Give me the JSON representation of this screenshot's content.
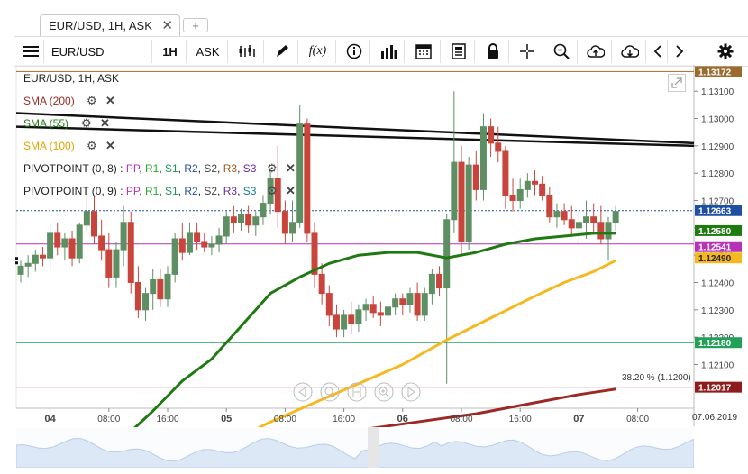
{
  "tab": {
    "title": "EUR/USD, 1H, ASK",
    "close": "✕",
    "add": "+"
  },
  "toolbar": {
    "symbol": "EUR/USD",
    "period": "1H",
    "side": "ASK",
    "fx": "f(x)"
  },
  "chart_title": "EUR/USD, 1H, ASK",
  "colors": {
    "sma200": "#9b2a26",
    "sma55": "#1f7a12",
    "sma100": "#f5b820",
    "up": "#5e8f63",
    "down": "#c9453c"
  },
  "indicators": {
    "sma200": "SMA (200)",
    "sma55": "SMA (55)",
    "sma100": "SMA (100)",
    "pivot1": {
      "name": "PIVOTPOINT (0, 8)",
      "sep": " : ",
      "pp": "PP",
      "r1": "R1",
      "s1": "S1",
      "r2": "R2",
      "s2": "S2",
      "r3": "R3",
      "s3": "S3"
    },
    "pivot2": {
      "name": "PIVOTPOINT (0, 9)",
      "sep": " : ",
      "pp": "PP",
      "r1": "R1",
      "s1": "S1",
      "r2": "R2",
      "s2": "S2",
      "r3": "R3",
      "s3": "S3"
    }
  },
  "fib_label": "38.20 % (1.1200)",
  "date_label": "07.06.2019",
  "chart_data": {
    "type": "candlestick",
    "title": "EUR/USD, 1H, ASK",
    "ylim": [
      1.1194,
      1.1317
    ],
    "y_ticks": [
      "1.13100",
      "1.13000",
      "1.12900",
      "1.12800",
      "1.12700",
      "1.12600",
      "1.12500",
      "1.12400",
      "1.12300",
      "1.12200",
      "1.12100"
    ],
    "y_tick_values": [
      1.131,
      1.13,
      1.129,
      1.128,
      1.127,
      1.126,
      1.125,
      1.124,
      1.123,
      1.122,
      1.121
    ],
    "x_ticks": [
      "04",
      "08:00",
      "16:00",
      "05",
      "08:00",
      "16:00",
      "06",
      "08:00",
      "16:00",
      "07",
      "08:00"
    ],
    "x_tick_index": [
      4,
      12,
      20,
      28,
      36,
      44,
      52,
      60,
      68,
      76,
      84
    ],
    "price_tags": [
      {
        "label": "1.13172",
        "value": 1.13172,
        "color": "#9b6a2e",
        "line": true
      },
      {
        "label": "1.12663",
        "value": 1.12663,
        "color": "#1e4fa3",
        "line": true,
        "dashed": true
      },
      {
        "label": "1.12580",
        "value": 1.1258,
        "color": "#1f7a12",
        "line": false
      },
      {
        "label": "1.12541",
        "value": 1.12541,
        "color": "#b633b6",
        "line": true
      },
      {
        "label": "1.12490",
        "value": 1.1249,
        "color": "#f5b820",
        "line": false
      },
      {
        "label": "1.12180",
        "value": 1.1218,
        "color": "#22a05a",
        "line": true
      },
      {
        "label": "1.12017",
        "value": 1.12017,
        "color": "#8e1c1c",
        "line": true
      }
    ],
    "trendlines": [
      {
        "from": [
          0,
          1.1302
        ],
        "to": [
          89,
          1.1291
        ],
        "color": "#111"
      },
      {
        "from": [
          0,
          1.1297
        ],
        "to": [
          89,
          1.129
        ],
        "color": "#111"
      }
    ],
    "candles": [
      [
        1.1243,
        1.1248,
        1.124,
        1.1246
      ],
      [
        1.1246,
        1.125,
        1.1242,
        1.1247
      ],
      [
        1.1247,
        1.1252,
        1.1244,
        1.125
      ],
      [
        1.125,
        1.1253,
        1.1246,
        1.1249
      ],
      [
        1.1249,
        1.1262,
        1.1245,
        1.1258
      ],
      [
        1.1258,
        1.1262,
        1.125,
        1.1253
      ],
      [
        1.1253,
        1.1258,
        1.1248,
        1.1256
      ],
      [
        1.1256,
        1.1259,
        1.1246,
        1.1249
      ],
      [
        1.1249,
        1.1262,
        1.1247,
        1.1261
      ],
      [
        1.1261,
        1.1275,
        1.1258,
        1.1266
      ],
      [
        1.1266,
        1.1272,
        1.1254,
        1.1257
      ],
      [
        1.1257,
        1.1263,
        1.1248,
        1.1252
      ],
      [
        1.1252,
        1.1258,
        1.1238,
        1.1242
      ],
      [
        1.1242,
        1.1255,
        1.1238,
        1.1252
      ],
      [
        1.1252,
        1.1268,
        1.1246,
        1.1262
      ],
      [
        1.1262,
        1.1266,
        1.1236,
        1.124
      ],
      [
        1.124,
        1.1246,
        1.1227,
        1.123
      ],
      [
        1.123,
        1.1238,
        1.1226,
        1.1236
      ],
      [
        1.1236,
        1.1245,
        1.123,
        1.1241
      ],
      [
        1.1241,
        1.1245,
        1.1231,
        1.1234
      ],
      [
        1.1234,
        1.1246,
        1.1231,
        1.1243
      ],
      [
        1.1243,
        1.1258,
        1.124,
        1.1256
      ],
      [
        1.1256,
        1.1262,
        1.1248,
        1.1251
      ],
      [
        1.1251,
        1.1262,
        1.125,
        1.1258
      ],
      [
        1.1258,
        1.1262,
        1.1252,
        1.1255
      ],
      [
        1.1255,
        1.1258,
        1.1251,
        1.1253
      ],
      [
        1.1253,
        1.1257,
        1.125,
        1.1254
      ],
      [
        1.1254,
        1.126,
        1.1251,
        1.1257
      ],
      [
        1.1257,
        1.1266,
        1.1254,
        1.1264
      ],
      [
        1.1264,
        1.1268,
        1.1258,
        1.1262
      ],
      [
        1.1262,
        1.1267,
        1.1259,
        1.1265
      ],
      [
        1.1265,
        1.1268,
        1.1258,
        1.1261
      ],
      [
        1.1261,
        1.1266,
        1.1257,
        1.1264
      ],
      [
        1.1264,
        1.1272,
        1.1261,
        1.1269
      ],
      [
        1.1269,
        1.1282,
        1.1265,
        1.1278
      ],
      [
        1.1278,
        1.129,
        1.126,
        1.1266
      ],
      [
        1.1266,
        1.127,
        1.1254,
        1.1258
      ],
      [
        1.1258,
        1.127,
        1.1255,
        1.1262
      ],
      [
        1.1262,
        1.1305,
        1.126,
        1.1298
      ],
      [
        1.1298,
        1.13,
        1.1255,
        1.1258
      ],
      [
        1.1258,
        1.1262,
        1.1238,
        1.1243
      ],
      [
        1.1243,
        1.1247,
        1.1232,
        1.1236
      ],
      [
        1.1236,
        1.1239,
        1.1224,
        1.1228
      ],
      [
        1.1228,
        1.1232,
        1.122,
        1.1223
      ],
      [
        1.1223,
        1.123,
        1.122,
        1.1228
      ],
      [
        1.1228,
        1.1233,
        1.1221,
        1.1225
      ],
      [
        1.1225,
        1.1232,
        1.1222,
        1.123
      ],
      [
        1.123,
        1.1234,
        1.1226,
        1.1232
      ],
      [
        1.1232,
        1.1235,
        1.1227,
        1.1229
      ],
      [
        1.1229,
        1.1233,
        1.1224,
        1.1228
      ],
      [
        1.1228,
        1.1233,
        1.1222,
        1.1231
      ],
      [
        1.1231,
        1.1236,
        1.1228,
        1.1234
      ],
      [
        1.1234,
        1.1236,
        1.1228,
        1.1232
      ],
      [
        1.1232,
        1.1238,
        1.1229,
        1.1236
      ],
      [
        1.1236,
        1.124,
        1.1226,
        1.1228
      ],
      [
        1.1228,
        1.1238,
        1.1226,
        1.1236
      ],
      [
        1.1236,
        1.1245,
        1.1232,
        1.1243
      ],
      [
        1.1243,
        1.1246,
        1.1235,
        1.1238
      ],
      [
        1.1238,
        1.1265,
        1.1203,
        1.1263
      ],
      [
        1.1263,
        1.131,
        1.1258,
        1.1284
      ],
      [
        1.1284,
        1.129,
        1.125,
        1.1255
      ],
      [
        1.1255,
        1.1286,
        1.1252,
        1.1283
      ],
      [
        1.1283,
        1.1288,
        1.127,
        1.1274
      ],
      [
        1.1274,
        1.1302,
        1.127,
        1.1297
      ],
      [
        1.1297,
        1.13,
        1.1286,
        1.1291
      ],
      [
        1.1291,
        1.1297,
        1.1284,
        1.1288
      ],
      [
        1.1288,
        1.129,
        1.1267,
        1.1272
      ],
      [
        1.1272,
        1.1278,
        1.1266,
        1.127
      ],
      [
        1.127,
        1.1278,
        1.1267,
        1.1274
      ],
      [
        1.1274,
        1.128,
        1.1271,
        1.1277
      ],
      [
        1.1277,
        1.1281,
        1.1272,
        1.1276
      ],
      [
        1.1276,
        1.1279,
        1.127,
        1.1272
      ],
      [
        1.1272,
        1.1275,
        1.1262,
        1.1264
      ],
      [
        1.1264,
        1.1269,
        1.126,
        1.1266
      ],
      [
        1.1266,
        1.1269,
        1.1261,
        1.1263
      ],
      [
        1.1263,
        1.1268,
        1.1257,
        1.126
      ],
      [
        1.126,
        1.1266,
        1.1254,
        1.1262
      ],
      [
        1.1262,
        1.127,
        1.1256,
        1.1264
      ],
      [
        1.1264,
        1.1269,
        1.1258,
        1.1262
      ],
      [
        1.1262,
        1.1268,
        1.1254,
        1.1256
      ],
      [
        1.1256,
        1.1264,
        1.1248,
        1.1262
      ],
      [
        1.1262,
        1.1268,
        1.1259,
        1.1266
      ]
    ],
    "sma55": [
      [
        10,
        1.1174
      ],
      [
        14,
        1.1183
      ],
      [
        18,
        1.1193
      ],
      [
        22,
        1.1204
      ],
      [
        26,
        1.1212
      ],
      [
        30,
        1.1224
      ],
      [
        34,
        1.1236
      ],
      [
        38,
        1.1242
      ],
      [
        42,
        1.1247
      ],
      [
        46,
        1.125
      ],
      [
        50,
        1.1251
      ],
      [
        54,
        1.1251
      ],
      [
        58,
        1.1249
      ],
      [
        62,
        1.1251
      ],
      [
        66,
        1.1254
      ],
      [
        70,
        1.1256
      ],
      [
        74,
        1.1257
      ],
      [
        78,
        1.1258
      ],
      [
        81,
        1.1258
      ]
    ],
    "sma100": [
      [
        28,
        1.1181
      ],
      [
        34,
        1.1189
      ],
      [
        40,
        1.1196
      ],
      [
        46,
        1.1203
      ],
      [
        52,
        1.121
      ],
      [
        58,
        1.1219
      ],
      [
        64,
        1.1227
      ],
      [
        70,
        1.1235
      ],
      [
        74,
        1.124
      ],
      [
        78,
        1.1244
      ],
      [
        81,
        1.1248
      ]
    ],
    "sma200": [
      [
        38,
        1.1182
      ],
      [
        46,
        1.1186
      ],
      [
        54,
        1.1189
      ],
      [
        62,
        1.1192
      ],
      [
        70,
        1.1196
      ],
      [
        76,
        1.1199
      ],
      [
        81,
        1.1201
      ]
    ]
  }
}
